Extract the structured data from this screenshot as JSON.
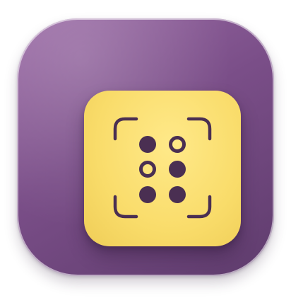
{
  "icon": {
    "name": "braille-scanner-app-icon",
    "colors": {
      "background_top": "#9a6aa5",
      "background_bottom": "#5f3c6d",
      "tile": "#f9dc6a",
      "glyph": "#4a2f52"
    },
    "braille_cells": [
      {
        "row": 1,
        "col": 1,
        "filled": true
      },
      {
        "row": 1,
        "col": 2,
        "filled": false
      },
      {
        "row": 2,
        "col": 1,
        "filled": false
      },
      {
        "row": 2,
        "col": 2,
        "filled": true
      },
      {
        "row": 3,
        "col": 1,
        "filled": true
      },
      {
        "row": 3,
        "col": 2,
        "filled": true
      }
    ]
  }
}
